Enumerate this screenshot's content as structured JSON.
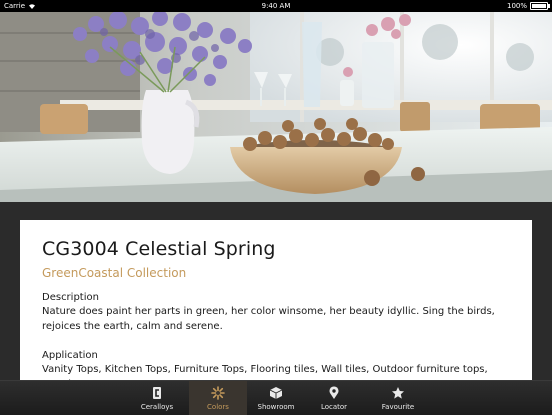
{
  "status": {
    "carrier": "Carrie",
    "time": "9:40 AM",
    "battery": "100%"
  },
  "product": {
    "title": "CG3004 Celestial Spring",
    "collection": "GreenCoastal Collection",
    "description_label": "Description",
    "description": "Nature does paint her parts in green, her color winsome, her beauty idyllic.  Sing the birds, rejoices the earth, calm and serene.",
    "application_label": "Application",
    "application": "Vanity Tops, Kitchen Tops, Furniture Tops, Flooring tiles, Wall tiles, Outdoor furniture tops, Facade"
  },
  "tabs": [
    {
      "label": "Ceralloys",
      "icon": "ceralloys-logo-icon",
      "active": false
    },
    {
      "label": "Colors",
      "icon": "flower-icon",
      "active": true
    },
    {
      "label": "Showroom",
      "icon": "cube-icon",
      "active": false
    },
    {
      "label": "Locator",
      "icon": "map-pin-icon",
      "active": false
    },
    {
      "label": "Favourite",
      "icon": "star-icon",
      "active": false
    }
  ],
  "colors": {
    "accent": "#c49a5c",
    "tab_bar": "#222222",
    "card": "#ffffff"
  }
}
